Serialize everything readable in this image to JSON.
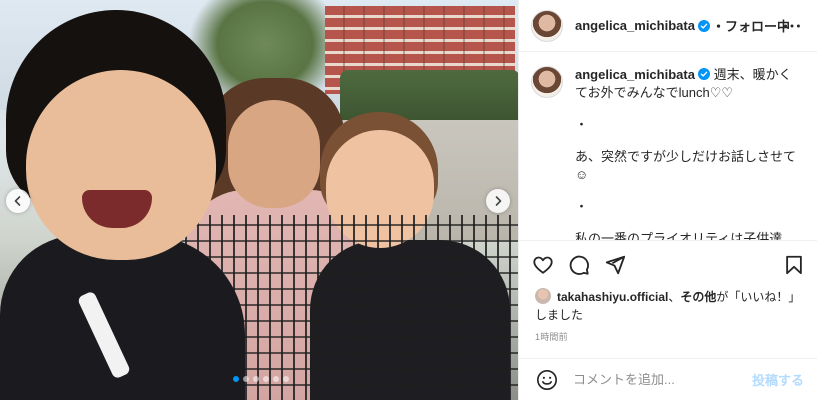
{
  "post": {
    "username": "angelica_michibata",
    "follow_label": "・フォロー中",
    "caption": {
      "username": "angelica_michibata",
      "lines": [
        "週末、暖かくてお外でみんなでlunch♡♡",
        "・",
        "あ、突然ですが少しだけお話しさせて☺",
        "・",
        "私の一番のプライオリティは子供達"
      ]
    },
    "likes": {
      "user": "takahashiyu.official",
      "separator": "、",
      "others_label": "その他",
      "suffix": "が「いいね！」しました"
    },
    "timestamp": "1時間前",
    "comment": {
      "placeholder": "コメントを追加...",
      "post_label": "投稿する"
    },
    "carousel": {
      "count": 6,
      "active_index": 0
    }
  },
  "icons": {
    "more": "more-horizontal-icon",
    "like": "heart-icon",
    "comment": "comment-bubble-icon",
    "share": "paper-plane-icon",
    "save": "bookmark-icon",
    "emoji": "smiley-icon",
    "prev": "chevron-left-icon",
    "next": "chevron-right-icon",
    "verified": "verified-badge-icon"
  },
  "colors": {
    "verified": "#0095f6",
    "active_dot": "#0095f6",
    "post_button": "#b3dbff"
  }
}
